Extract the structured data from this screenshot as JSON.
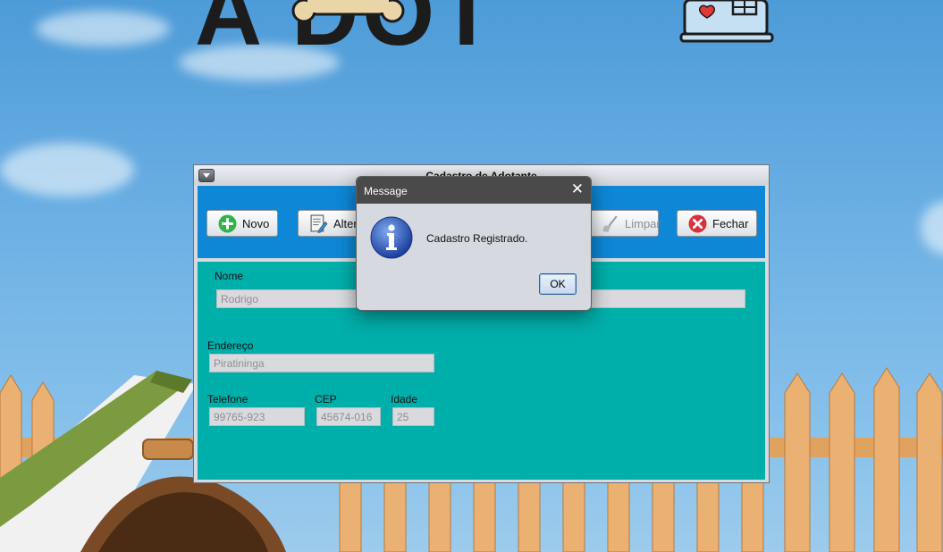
{
  "logo": {
    "text": "A DOT"
  },
  "frame": {
    "title": "Cadastro de Adotante"
  },
  "toolbar": {
    "novo": "Novo",
    "alterar": "Alterar",
    "limpar": "Limpar",
    "fechar": "Fechar"
  },
  "form": {
    "nome_label": "Nome",
    "nome_value": "Rodrigo",
    "endereco_label": "Endereço",
    "endereco_value": "Piratininga",
    "telefone_label": "Telefone",
    "telefone_value": "99765-923",
    "cep_label": "CEP",
    "cep_value": "45674-016",
    "idade_label": "Idade",
    "idade_value": "25"
  },
  "dialog": {
    "title": "Message",
    "message": "Cadastro Registrado.",
    "ok": "OK"
  },
  "colors": {
    "toolbar": "#0e87d6",
    "form_bg": "#00aeaa",
    "dialog_title": "#4a4a4a"
  },
  "icons": [
    "plus-icon",
    "edit-document-icon",
    "broom-icon",
    "close-circle-icon",
    "info-icon",
    "doghouse-icon",
    "bone-icon"
  ]
}
